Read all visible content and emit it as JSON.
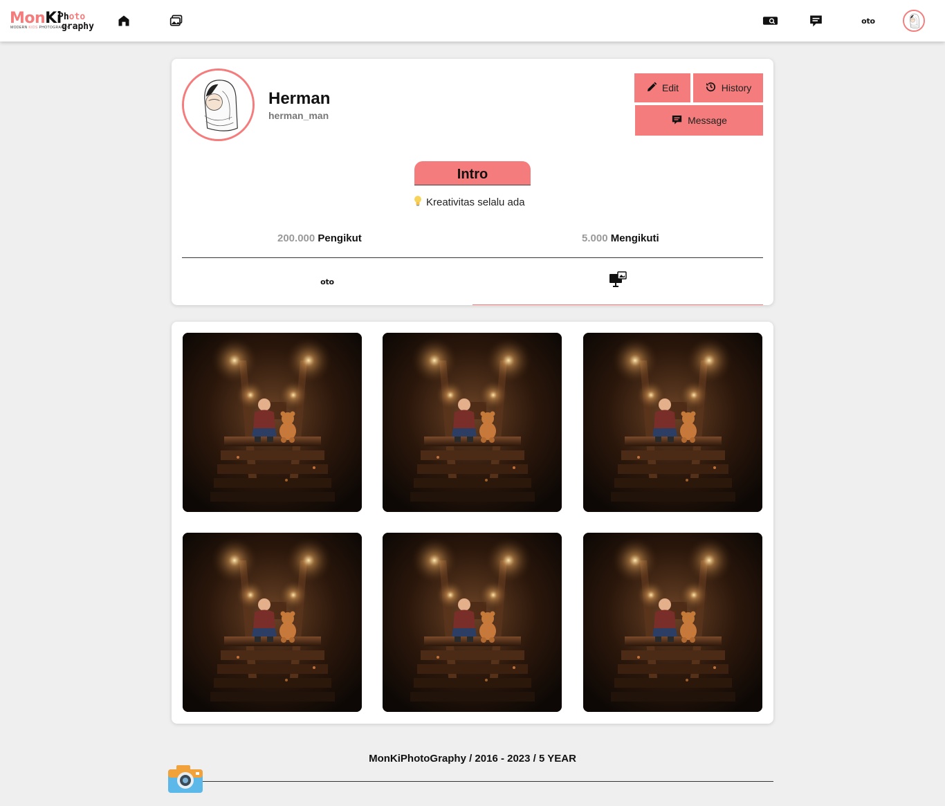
{
  "brand": {
    "logo_part1": "Mon",
    "logo_part2": "Ki",
    "logo_photo_a": "Ph",
    "logo_photo_b": "o",
    "logo_photo_c": "t",
    "logo_photo_d": "o",
    "logo_graphy": "graphy",
    "tagline_a": "MODERN ",
    "tagline_b": "KIDS",
    "tagline_c": " PHOTOGRAPHY",
    "accent_color": "#f47c7c"
  },
  "topnav": {
    "icons": [
      "home-icon",
      "photos-icon",
      "id-card-search-icon",
      "chat-icon",
      "oto-icon",
      "user-avatar"
    ],
    "oto_label": "oto"
  },
  "profile": {
    "name": "Herman",
    "username": "herman_man",
    "buttons": {
      "edit": "Edit",
      "history": "History",
      "message": "Message"
    },
    "intro_title": "Intro",
    "intro_text": "Kreativitas selalu ada",
    "followers_count": "200.000",
    "followers_label": "Pengikut",
    "following_count": "5.000",
    "following_label": "Mengikuti",
    "tabs": [
      {
        "name": "oto-tab",
        "label": "oto"
      },
      {
        "name": "gallery-tab",
        "icon": "monitor-gallery-icon"
      }
    ],
    "active_tab": 1
  },
  "gallery": {
    "photos": [
      "child-with-teddy-bear-on-stairs",
      "child-with-teddy-bear-on-stairs",
      "child-with-teddy-bear-on-stairs",
      "child-with-teddy-bear-on-stairs",
      "child-with-teddy-bear-on-stairs",
      "child-with-teddy-bear-on-stairs"
    ]
  },
  "footer": {
    "text": "MonKiPhotoGraphy / 2016 - 2023 / 5 YEAR",
    "icon": "camera-icon"
  }
}
